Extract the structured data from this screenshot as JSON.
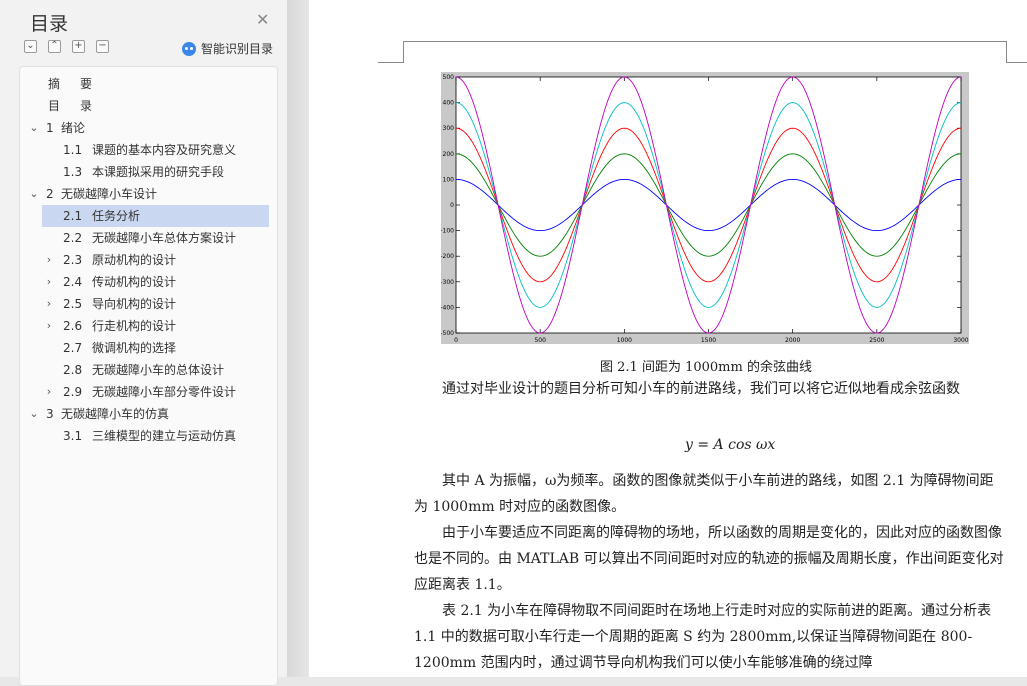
{
  "sidebar": {
    "title": "目录",
    "smart_label": "智能识别目录",
    "buttons": [
      "⌄",
      "⌃",
      "+",
      "−"
    ],
    "items": [
      {
        "num": "摘",
        "label": "要",
        "level": 0,
        "chev": ""
      },
      {
        "num": "目",
        "label": "录",
        "level": 0,
        "chev": ""
      },
      {
        "num": "1",
        "label": "绪论",
        "level": 0,
        "chev": "⌄"
      },
      {
        "num": "1.1",
        "label": "课题的基本内容及研究意义",
        "level": 1,
        "chev": ""
      },
      {
        "num": "1.3",
        "label": "本课题拟采用的研究手段",
        "level": 1,
        "chev": ""
      },
      {
        "num": "2",
        "label": "无碳越障小车设计",
        "level": 0,
        "chev": "⌄"
      },
      {
        "num": "2.1",
        "label": "任务分析",
        "level": 1,
        "chev": "",
        "selected": true
      },
      {
        "num": "2.2",
        "label": "无碳越障小车总体方案设计",
        "level": 1,
        "chev": ""
      },
      {
        "num": "2.3",
        "label": "原动机构的设计",
        "level": 1,
        "chev": "›"
      },
      {
        "num": "2.4",
        "label": "传动机构的设计",
        "level": 1,
        "chev": "›"
      },
      {
        "num": "2.5",
        "label": "导向机构的设计",
        "level": 1,
        "chev": "›"
      },
      {
        "num": "2.6",
        "label": "行走机构的设计",
        "level": 1,
        "chev": "›"
      },
      {
        "num": "2.7",
        "label": "微调机构的选择",
        "level": 1,
        "chev": ""
      },
      {
        "num": "2.8",
        "label": "无碳越障小车的总体设计",
        "level": 1,
        "chev": ""
      },
      {
        "num": "2.9",
        "label": "无碳越障小车部分零件设计",
        "level": 1,
        "chev": "›"
      },
      {
        "num": "3",
        "label": "无碳越障小车的仿真",
        "level": 0,
        "chev": "⌄"
      },
      {
        "num": "3.1",
        "label": "三维模型的建立与运动仿真",
        "level": 1,
        "chev": ""
      }
    ]
  },
  "document": {
    "caption": "图 2.1 间距为 1000mm 的余弦曲线",
    "formula": "y = A cos ωx",
    "paragraphs": [
      "　　通过对毕业设计的题目分析可知小车的前进路线，我们可以将它近似地看成余弦函数",
      "　　其中 A 为振幅，ω为频率。函数的图像就类似于小车前进的路线，如图 2.1 为障碍物间距为 1000mm 时对应的函数图像。",
      "　　由于小车要适应不同距离的障碍物的场地，所以函数的周期是变化的，因此对应的函数图像也是不同的。由 MATLAB 可以算出不同间距时对应的轨迹的振幅及周期长度，作出间距变化对应距离表 1.1。",
      "　　表 2.1 为小车在障碍物取不同间距时在场地上行走时对应的实际前进的距离。通过分析表 1.1 中的数据可取小车行走一个周期的距离 S 约为 2800mm,以保证当障碍物间距在 800-1200mm 范围内时，通过调节导向机构我们可以使小车能够准确的绕过障"
    ]
  },
  "chart_data": {
    "type": "line",
    "title": "",
    "xlabel": "",
    "ylabel": "",
    "xlim": [
      0,
      3000
    ],
    "ylim": [
      -500,
      500
    ],
    "x_ticks": [
      0,
      500,
      1000,
      1500,
      2000,
      2500,
      3000
    ],
    "y_ticks": [
      500,
      400,
      300,
      200,
      100,
      0,
      -100,
      -200,
      -300,
      -400,
      -500
    ],
    "function": "y = A cos(2πx/1000)",
    "series": [
      {
        "amplitude": 100,
        "color": "#0000ff"
      },
      {
        "amplitude": 200,
        "color": "#008000"
      },
      {
        "amplitude": 300,
        "color": "#ff0000"
      },
      {
        "amplitude": 400,
        "color": "#00bfbf"
      },
      {
        "amplitude": 500,
        "color": "#bf00bf"
      }
    ],
    "grid": false
  }
}
